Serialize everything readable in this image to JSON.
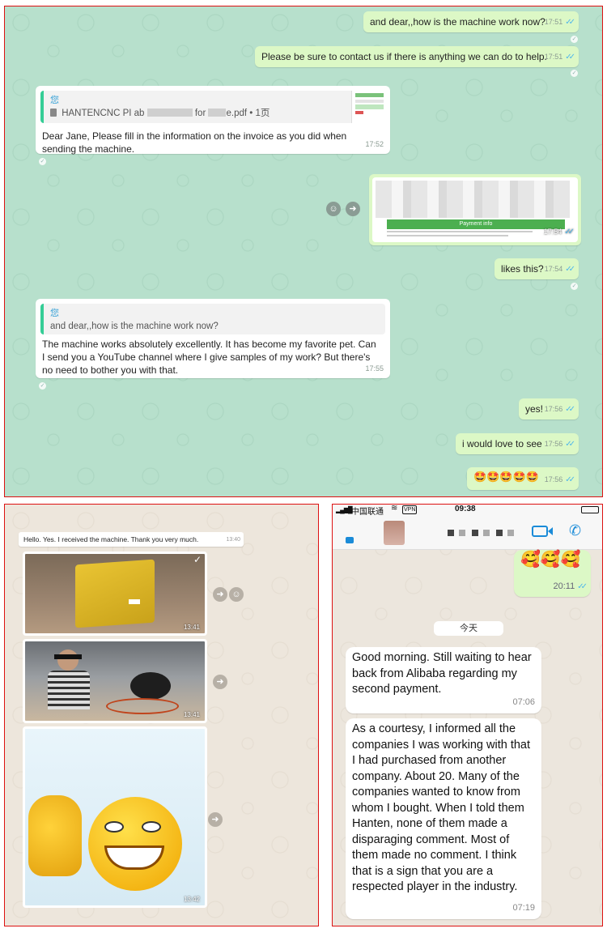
{
  "top": {
    "messages_out": [
      {
        "text": "and dear,,how is the machine work now?",
        "time": "17:51"
      },
      {
        "text": "Please be sure to contact us if there is anything we can do to help.",
        "time": "17:51"
      },
      {
        "text": "likes this?",
        "time": "17:54"
      },
      {
        "text": "yes!",
        "time": "17:56"
      },
      {
        "text": "i would love to see",
        "time": "17:56"
      },
      {
        "text": "🤩🤩🤩🤩🤩",
        "time": "17:56"
      }
    ],
    "doc_reply": {
      "quote_author": "您",
      "file_prefix": "HANTENCNC PI ab",
      "file_mid": "for",
      "file_suffix": "e.pdf • 1页",
      "text": "Dear Jane, Please fill in the information on the invoice as you did when sending the machine.",
      "time": "17:52"
    },
    "image_out": {
      "caption": "Payment info",
      "time": "17:54"
    },
    "long_reply": {
      "quote_author": "您",
      "quote_text": "and dear,,how is the machine work now?",
      "text": "The machine works absolutely excellently. It has become my favorite pet. Can I send you a YouTube channel where I give samples of my work? But there's no need to bother you with that.",
      "time": "17:55"
    }
  },
  "bottom_left": {
    "header_text": "Hello.  Yes. I received the machine.  Thank you very much.",
    "header_time": "13:40",
    "image_times": [
      "13:41",
      "13:41",
      "13:42"
    ]
  },
  "bottom_right": {
    "status": {
      "carrier": "中国联通",
      "vpn": "VPN",
      "time": "09:38"
    },
    "sent": {
      "text": "🥰🥰🥰",
      "time": "20:11"
    },
    "date_chip": "今天",
    "msg1": {
      "text": "Good morning. Still waiting to hear back from Alibaba regarding my second payment.",
      "time": "07:06"
    },
    "msg2": {
      "text": "As a courtesy, I informed all the companies I was working with that I had purchased from another company. About 20. Many of the companies wanted to know from whom I bought. When I told them Hanten, none of them made a disparaging comment. Most of them made no comment. I think that is a sign that you are a respected player in the industry.",
      "time": "07:19"
    }
  },
  "colors": {
    "out_bubble": "#dcf8c6",
    "chat_bg_top": "#b7e0cc",
    "tick": "#4fb6ec",
    "quote_bar": "#35cd96",
    "ios_blue": "#1a8bd8"
  }
}
